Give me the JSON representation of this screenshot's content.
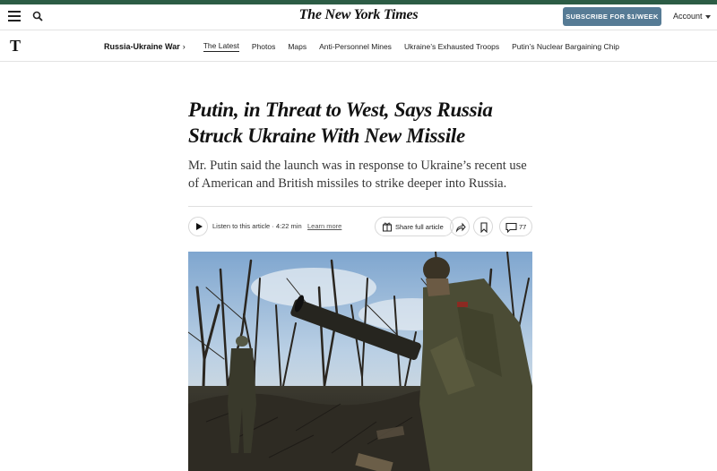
{
  "brand": {
    "accent_color": "#2c5c45",
    "logo": "The New York Times",
    "logo_short": "T"
  },
  "header": {
    "menu_icon": "hamburger-menu-icon",
    "search_icon": "search-icon",
    "subscribe_label": "SUBSCRIBE FOR $1/WEEK",
    "account_label": "Account"
  },
  "nav": {
    "section_label": "Russia-Ukraine War",
    "section_chevron": "›",
    "items": [
      {
        "label": "The Latest",
        "active": true
      },
      {
        "label": "Photos"
      },
      {
        "label": "Maps"
      },
      {
        "label": "Anti-Personnel Mines"
      },
      {
        "label": "Ukraine’s Exhausted Troops"
      },
      {
        "label": "Putin’s Nuclear Bargaining Chip"
      }
    ]
  },
  "article": {
    "headline": "Putin, in Threat to West, Says Russia Struck Ukraine With New Missile",
    "summary": "Mr. Putin said the launch was in response to Ukraine’s recent use of American and British missiles to strike deeper into Russia."
  },
  "toolbar": {
    "listen_label": "Listen to this article · 4:22 min",
    "learn_more": "Learn more",
    "share_label": "Share full article",
    "comment_count": "77",
    "icons": [
      "play-icon",
      "gift-icon",
      "share-arrow-icon",
      "bookmark-icon",
      "comment-icon"
    ]
  },
  "photo": {
    "description_icon": "soldiers-with-weapon-photo"
  }
}
